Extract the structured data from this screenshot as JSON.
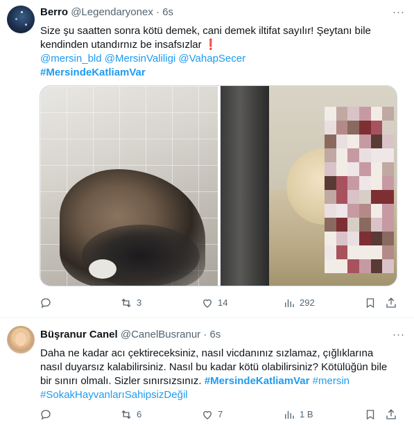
{
  "tweets": [
    {
      "name": "Berro",
      "handle": "@Legendaryonex",
      "separator": "·",
      "time": "6s",
      "line1": "Size şu saatten sonra kötü demek, cani demek iltifat sayılır! Şeytanı bile",
      "line2_text": "kendinden utandırnız be insafsızlar",
      "line2_emoji": "❗",
      "mentions": [
        "@mersin_bld",
        "@MersinValiligi",
        "@VahapSecer"
      ],
      "hashtag": "#MersindeKatliamVar",
      "stats": {
        "replies": "",
        "retweets": "3",
        "likes": "14",
        "views": "292"
      }
    },
    {
      "name": "Büşranur Canel",
      "handle": "@CanelBusranur",
      "separator": "·",
      "time": "6s",
      "line1": "Daha ne kadar acı çektireceksiniz, nasıl vicdanınız sızlamaz, çığlıklarına",
      "line2": "nasıl duyarsız kalabilirsiniz. Nasıl bu kadar kötü olabilirsiniz? Kötülüğün bile",
      "line3_text": "bir sınırı olmalı. Sizler sınırsızsınız.",
      "line3_hashtag1": "#MersindeKatliamVar",
      "line3_hashtag2": "#mersin",
      "line4_hashtag": "#SokakHayvanlarıSahipsizDeğil",
      "stats": {
        "replies": "",
        "retweets": "6",
        "likes": "7",
        "views": "1 B"
      }
    }
  ],
  "more_label": "···"
}
